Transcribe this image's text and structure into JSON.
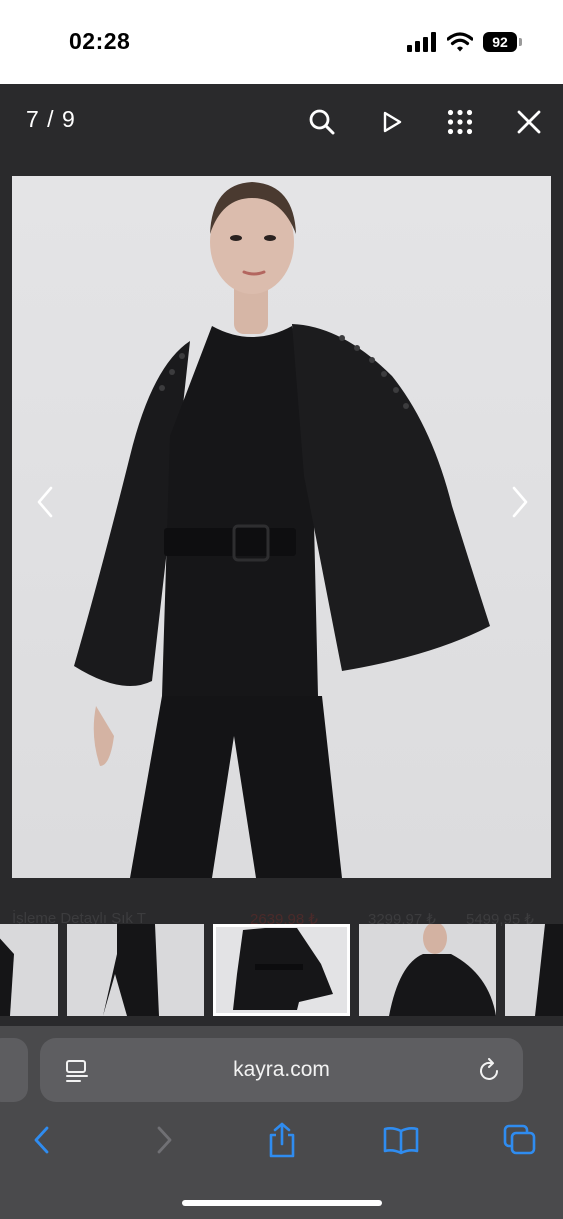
{
  "status_bar": {
    "time": "02:28",
    "battery": "92"
  },
  "viewer": {
    "counter": "7 / 9"
  },
  "page_behind": {
    "product_name": "İşleme Detaylı Şık T",
    "price_sale": "2639,98 ₺",
    "price_old_1": "3299,97 ₺",
    "price_old_2": "5499,95 ₺"
  },
  "browser": {
    "url": "kayra.com"
  },
  "colors": {
    "accent_blue": "#2f8cf0",
    "viewer_bg": "#2a2a2c",
    "browser_bg": "#4a4a4c"
  },
  "icons": [
    "signal-icon",
    "wifi-icon",
    "battery-icon",
    "search-icon",
    "play-icon",
    "grid-icon",
    "close-icon",
    "chevron-left-icon",
    "chevron-right-icon",
    "reader-icon",
    "reload-icon",
    "back-icon",
    "forward-icon",
    "share-icon",
    "bookmarks-icon",
    "tabs-icon"
  ]
}
